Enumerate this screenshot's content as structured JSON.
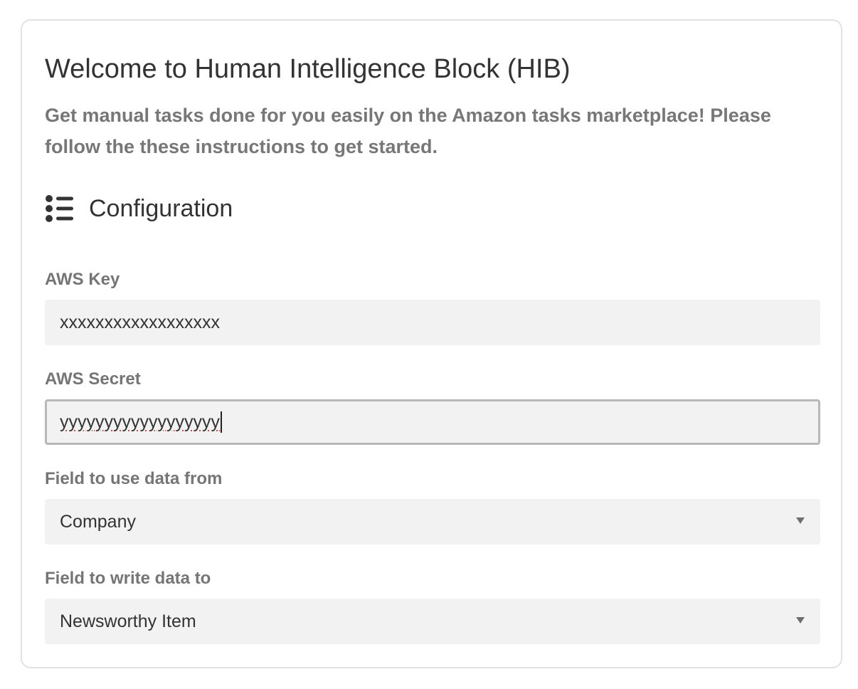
{
  "header": {
    "title": "Welcome to Human Intelligence Block (HIB)",
    "subtitle": "Get manual tasks done for you easily on the Amazon tasks marketplace! Please follow the these instructions to get started."
  },
  "configuration": {
    "section_title": "Configuration",
    "section_icon": "list-icon",
    "aws_key": {
      "label": "AWS Key",
      "value": "xxxxxxxxxxxxxxxxxx"
    },
    "aws_secret": {
      "label": "AWS Secret",
      "value": "yyyyyyyyyyyyyyyyyy"
    },
    "source_field": {
      "label": "Field to use data from",
      "selected": "Company"
    },
    "target_field": {
      "label": "Field to write data to",
      "selected": "Newsworthy Item"
    }
  },
  "colors": {
    "card_border": "#e2e2e2",
    "input_bg": "#f2f2f2",
    "muted_text": "#777777",
    "focus_border": "#b8b8b8",
    "spellcheck": "#e04a3a"
  }
}
